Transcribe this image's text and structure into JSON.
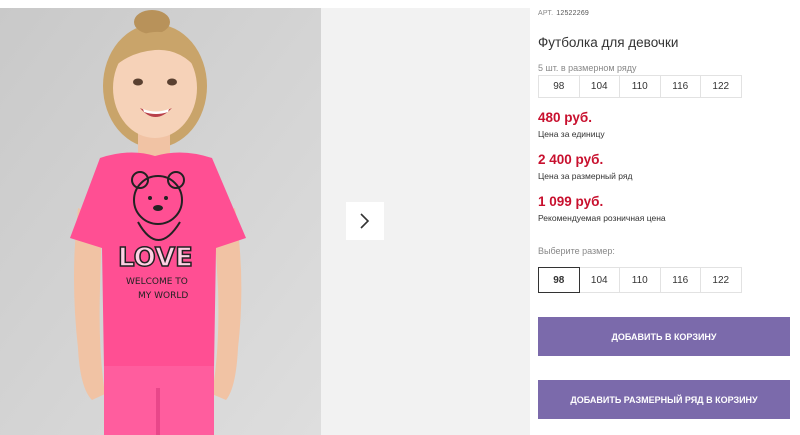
{
  "gallery": {
    "main_image": "girl-pink-tshirt-photo",
    "next_icon": "chevron-right-icon"
  },
  "product": {
    "article_label": "АРТ.",
    "article_value": "12522269",
    "title": "Футболка для девочки",
    "series_caption": "5 шт. в размерном ряду",
    "series_sizes": [
      "98",
      "104",
      "110",
      "116",
      "122"
    ],
    "prices": [
      {
        "value": "480 руб.",
        "caption": "Цена за единицу"
      },
      {
        "value": "2 400 руб.",
        "caption": "Цена за размерный ряд"
      },
      {
        "value": "1 099 руб.",
        "caption": "Рекомендуемая розничная цена"
      }
    ],
    "choose_caption": "Выберите размер:",
    "choose_sizes": [
      "98",
      "104",
      "110",
      "116",
      "122"
    ],
    "selected_size": "98",
    "add_to_cart": "ДОБАВИТЬ В КОРЗИНУ",
    "add_series_to_cart": "ДОБАВИТЬ РАЗМЕРНЫЙ РЯД В КОРЗИНУ"
  },
  "colors": {
    "price": "#c8102e",
    "button": "#7b6aab",
    "tshirt": "#ff4f93"
  }
}
